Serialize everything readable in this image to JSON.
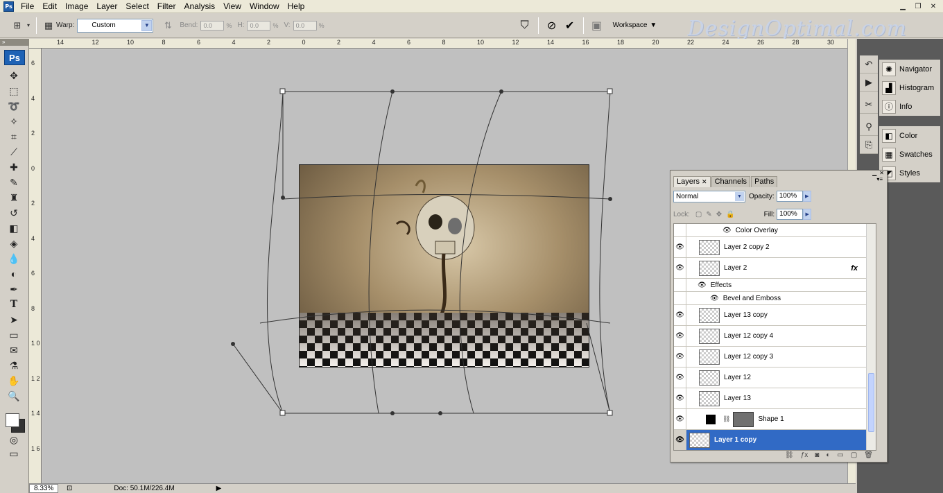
{
  "menubar": {
    "items": [
      "File",
      "Edit",
      "Image",
      "Layer",
      "Select",
      "Filter",
      "Analysis",
      "View",
      "Window",
      "Help"
    ]
  },
  "options": {
    "warp_label": "Warp:",
    "warp_value": "Custom",
    "bend_label": "Bend:",
    "bend_value": "0.0",
    "h_label": "H:",
    "h_value": "0.0",
    "v_label": "V:",
    "v_value": "0.0",
    "pct": "%",
    "workspace_label": "Workspace",
    "watermark": "DesignOptimal.com"
  },
  "toolbox": {
    "logo": "Ps",
    "tools": [
      "move-icon",
      "marquee-icon",
      "lasso-icon",
      "magic-wand-icon",
      "crop-icon",
      "slice-icon",
      "healing-icon",
      "brush-icon",
      "clone-stamp-icon",
      "history-brush-icon",
      "eraser-icon",
      "paint-bucket-icon",
      "blur-icon",
      "dodge-icon",
      "pen-icon",
      "type-icon",
      "path-select-icon",
      "shape-icon",
      "notes-icon",
      "eyedropper-icon",
      "hand-icon",
      "zoom-icon"
    ]
  },
  "ruler_top": [
    "14",
    "12",
    "10",
    "8",
    "6",
    "4",
    "2",
    "0",
    "2",
    "4",
    "6",
    "8",
    "10",
    "12",
    "14",
    "16",
    "18",
    "20",
    "22",
    "24",
    "26",
    "28",
    "30"
  ],
  "ruler_left": [
    "6",
    "4",
    "2",
    "0",
    "2",
    "4",
    "6",
    "8",
    "1 0",
    "1 2",
    "1 4",
    "1 6"
  ],
  "status": {
    "zoom": "8.33%",
    "doc": "Doc: 50.1M/226.4M"
  },
  "dock": {
    "group1": [
      "Navigator",
      "Histogram",
      "Info"
    ],
    "group2": [
      "Color",
      "Swatches",
      "Styles"
    ]
  },
  "layers_panel": {
    "tabs": [
      "Layers",
      "Channels",
      "Paths"
    ],
    "blend_mode": "Normal",
    "opacity_label": "Opacity:",
    "opacity_value": "100%",
    "lock_label": "Lock:",
    "fill_label": "Fill:",
    "fill_value": "100%",
    "fx_label": "fx",
    "layers": [
      {
        "name": "Color Overlay",
        "kind": "effect"
      },
      {
        "name": "Layer 2 copy 2",
        "kind": "layer"
      },
      {
        "name": "Layer 2",
        "kind": "layer"
      },
      {
        "name": "Effects",
        "kind": "effects-header"
      },
      {
        "name": "Bevel and Emboss",
        "kind": "effect"
      },
      {
        "name": "Layer 13 copy",
        "kind": "layer"
      },
      {
        "name": "Layer 12 copy 4",
        "kind": "layer"
      },
      {
        "name": "Layer 12 copy 3",
        "kind": "layer"
      },
      {
        "name": "Layer 12",
        "kind": "layer"
      },
      {
        "name": "Layer 13",
        "kind": "layer"
      },
      {
        "name": "Shape 1",
        "kind": "shape"
      },
      {
        "name": "Layer 1 copy",
        "kind": "selected"
      }
    ]
  }
}
